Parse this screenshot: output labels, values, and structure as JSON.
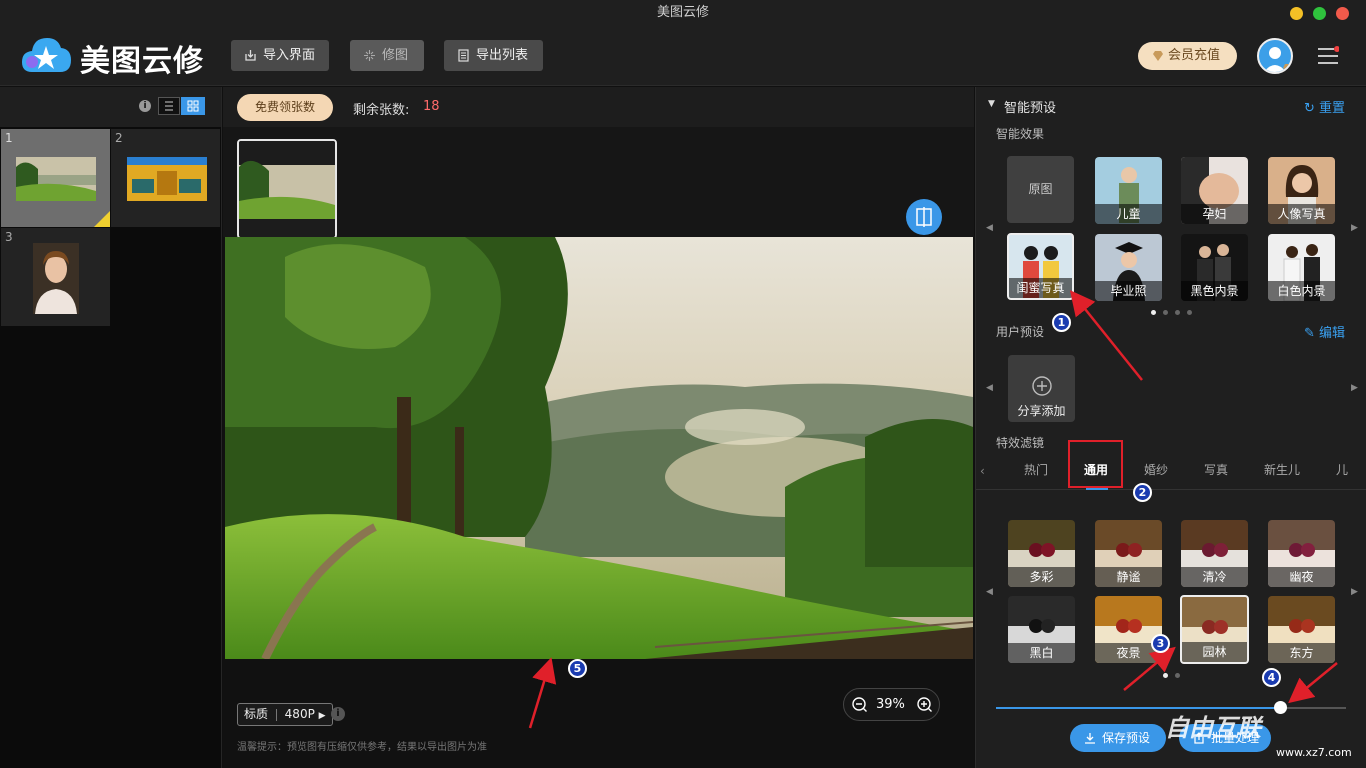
{
  "window": {
    "title": "美图云修"
  },
  "app": {
    "name": "美图云修"
  },
  "toolbar": {
    "import": "导入界面",
    "retouch": "修图",
    "export": "导出列表",
    "vip": "会员充值"
  },
  "left": {
    "thumbs": [
      "1",
      "2",
      "3"
    ]
  },
  "center": {
    "free_button": "免费领张数",
    "remaining_label": "剩余张数:",
    "remaining_count": "18",
    "compare": "对比",
    "quality_label": "标质",
    "quality_value": "480P",
    "zoom": "39%",
    "tip": "温馨提示：预览图有压缩仅供参考，结果以导出图片为准"
  },
  "right": {
    "smart_preset": "智能预设",
    "reset": "重置",
    "smart_effects": "智能效果",
    "presets": [
      "原图",
      "儿童",
      "孕妇",
      "人像写真",
      "闺蜜写真",
      "毕业照",
      "黑色内景",
      "白色内景"
    ],
    "user_preset": "用户预设",
    "edit": "编辑",
    "share_add": "分享添加",
    "special_filter": "特效滤镜",
    "tabs": [
      "热门",
      "通用",
      "婚纱",
      "写真",
      "新生儿",
      "儿"
    ],
    "filters": [
      "多彩",
      "静谧",
      "清冷",
      "幽夜",
      "黑白",
      "夜景",
      "园林",
      "东方"
    ],
    "slider_value": 0.81,
    "save_preset": "保存预设",
    "batch": "批量处理"
  },
  "annotations": [
    "1",
    "2",
    "3",
    "4",
    "5"
  ],
  "watermark": {
    "text": "自由互联",
    "url": "www.xz7.com"
  },
  "colors": {
    "accent": "#3a97e8",
    "annotation": "#1a3bb0",
    "arrow": "#e0202a"
  }
}
